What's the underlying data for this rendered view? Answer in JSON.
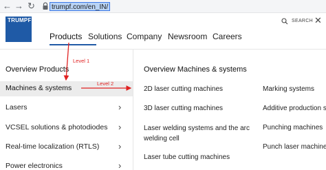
{
  "browser": {
    "back_glyph": "←",
    "forward_glyph": "→",
    "reload_glyph": "↻",
    "url": "trumpf.com/en_IN/"
  },
  "header": {
    "logo_text": "TRUMPF",
    "nav": [
      "Products",
      "Solutions",
      "Company",
      "Newsroom",
      "Careers"
    ],
    "search_label": "SEARCH",
    "close_glyph": "✕"
  },
  "level1": {
    "heading": "Overview Products",
    "items": [
      "Machines & systems",
      "Lasers",
      "VCSEL solutions & photodiodes",
      "Real-time localization (RTLS)",
      "Power electronics"
    ],
    "chevron_glyph": "›"
  },
  "level2": {
    "heading": "Overview Machines & systems",
    "col1": [
      "2D laser cutting machines",
      "3D laser cutting machines",
      "Laser welding systems and the arc welding cell",
      "Laser tube cutting machines"
    ],
    "col2": [
      "Marking systems",
      "Additive production sy",
      "Punching machines",
      "Punch laser machines"
    ]
  },
  "annotations": {
    "level1_label": "Level 1",
    "level2_label": "Level 2",
    "color": "#e02020"
  }
}
